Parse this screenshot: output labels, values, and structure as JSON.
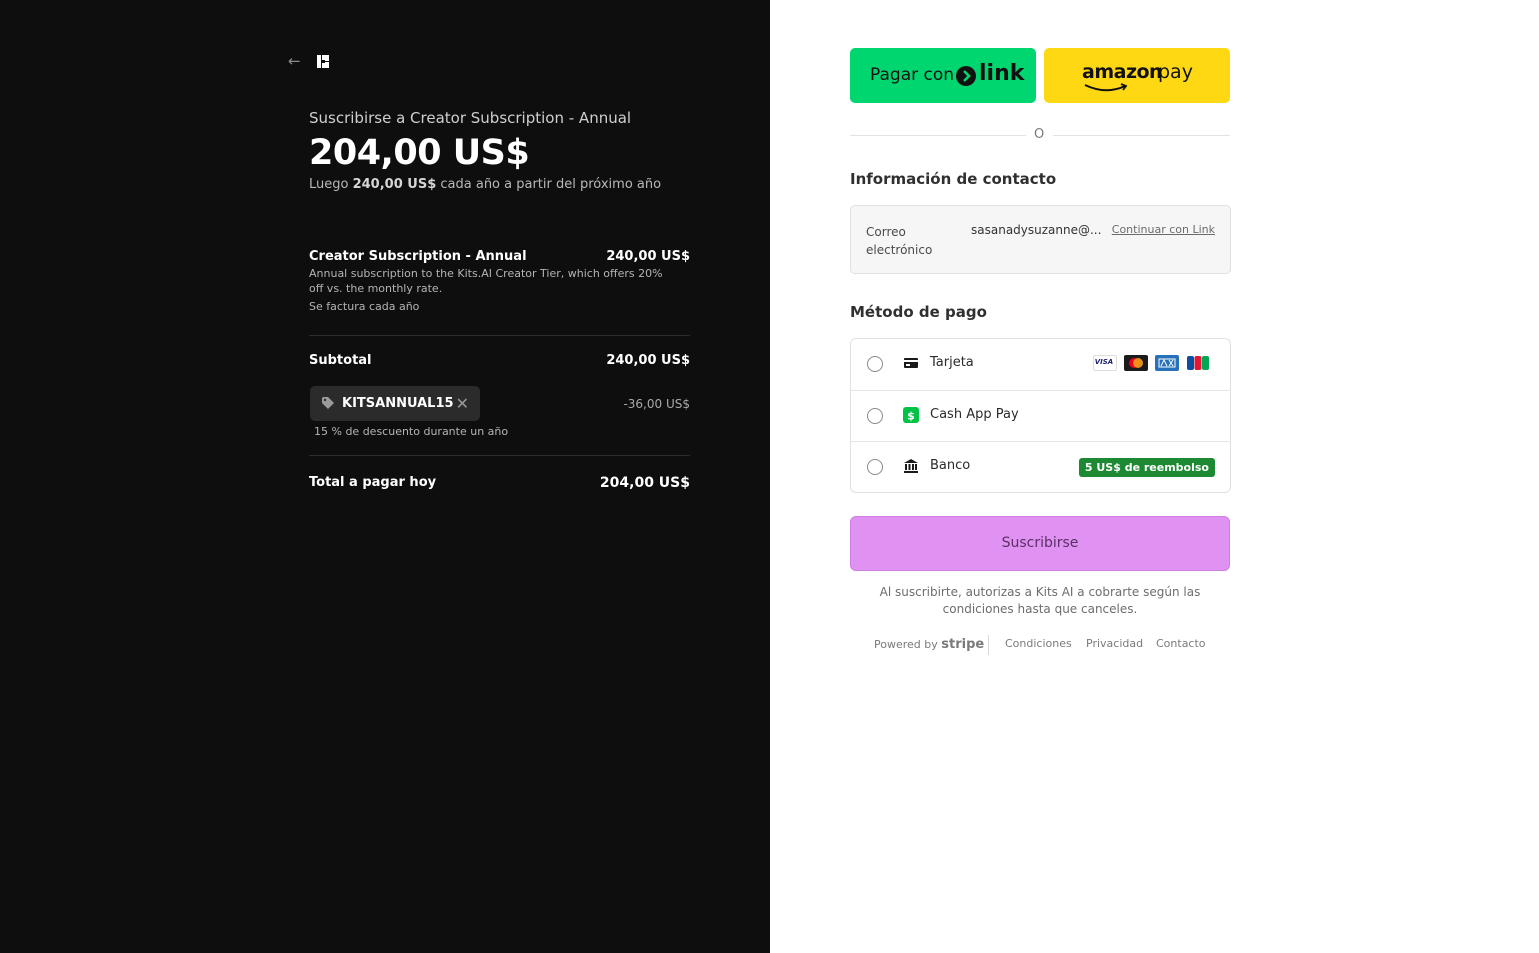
{
  "summary": {
    "back_icon": "arrow-left-icon",
    "logo_icon": "kits-logo-icon",
    "title": "Suscribirse a Creator Subscription - Annual",
    "price": "204,00 US$",
    "then_prefix": "Luego ",
    "then_amount": "240,00 US$",
    "then_suffix": " cada año a partir del próximo año",
    "item": {
      "name": "Creator Subscription - Annual",
      "price": "240,00 US$",
      "description": "Annual subscription to the Kits.AI Creator Tier, which offers 20% off vs. the monthly rate.",
      "billing": "Se factura cada año"
    },
    "subtotal_label": "Subtotal",
    "subtotal_value": "240,00 US$",
    "promo": {
      "code": "KITSANNUAL15",
      "description": "15 % de descuento durante un año",
      "discount": "-36,00 US$",
      "remove_icon": "close-icon",
      "tag_icon": "tag-icon"
    },
    "total_label": "Total a pagar hoy",
    "total_value": "204,00 US$"
  },
  "express": {
    "link_prefix": "Pagar con",
    "link_brand": "link",
    "amazon_brand": "amazon",
    "amazon_pay": "pay",
    "or": "O"
  },
  "contact": {
    "heading": "Información de contacto",
    "email_label": "Correo electrónico",
    "email_value": "sasanadysuzanne@...",
    "link_action": "Continuar con Link"
  },
  "payment": {
    "heading": "Método de pago",
    "methods": [
      {
        "label": "Tarjeta",
        "icon": "card-icon"
      },
      {
        "label": "Cash App Pay",
        "icon": "cash-app-icon"
      },
      {
        "label": "Banco",
        "icon": "bank-icon",
        "badge": "5 US$ de reembolso"
      }
    ],
    "card_brands": [
      "VISA",
      "mastercard",
      "amex",
      "JCB"
    ]
  },
  "subscribe_label": "Suscribirse",
  "terms": "Al suscribirte, autorizas a Kits AI a cobrarte según las condiciones hasta que canceles.",
  "footer": {
    "powered": "Powered by",
    "stripe": "stripe",
    "links": [
      "Condiciones",
      "Privacidad",
      "Contacto"
    ]
  },
  "colors": {
    "left_bg": "#0e0e0e",
    "link_green": "#00d66f",
    "amazon_yellow": "#ffd814",
    "subscribe_bg": "#df92f2",
    "badge_green": "#1d8a33"
  }
}
